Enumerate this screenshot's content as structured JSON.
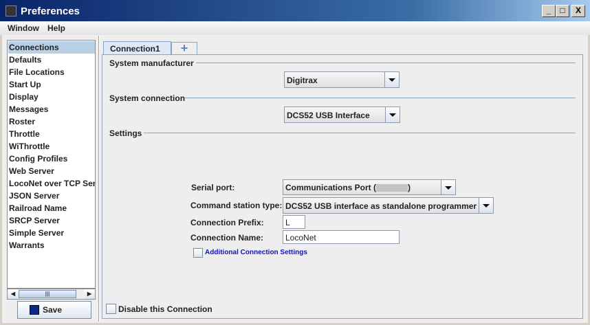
{
  "window": {
    "title": "Preferences",
    "minimize": "_",
    "maximize": "□",
    "close": "X"
  },
  "menu": {
    "items": [
      "Window",
      "Help"
    ]
  },
  "sidebar": {
    "items": [
      "Connections",
      "Defaults",
      "File Locations",
      "Start Up",
      "Display",
      "Messages",
      "Roster",
      "Throttle",
      "WiThrottle",
      "Config Profiles",
      "Web Server",
      "LocoNet over TCP Server",
      "JSON Server",
      "Railroad Name",
      "SRCP Server",
      "Simple Server",
      "Warrants"
    ],
    "selected": "Connections"
  },
  "save_label": "Save",
  "tabs": {
    "active": "Connection1",
    "add": "+"
  },
  "sections": {
    "manufacturer": "System manufacturer",
    "connection": "System connection",
    "settings": "Settings"
  },
  "manufacturer_value": "Digitrax",
  "connection_value": "DCS52 USB Interface",
  "settings": {
    "serial_port_label": "Serial port:",
    "serial_port_value": "Communications Port (",
    "serial_port_suffix": ")",
    "cs_type_label": "Command station type:",
    "cs_type_value": "DCS52 USB interface as standalone programmer",
    "prefix_label": "Connection Prefix:",
    "prefix_value": "L",
    "name_label": "Connection Name:",
    "name_value": "LocoNet",
    "additional": "Additional Connection Settings"
  },
  "disable_label": "Disable this Connection"
}
